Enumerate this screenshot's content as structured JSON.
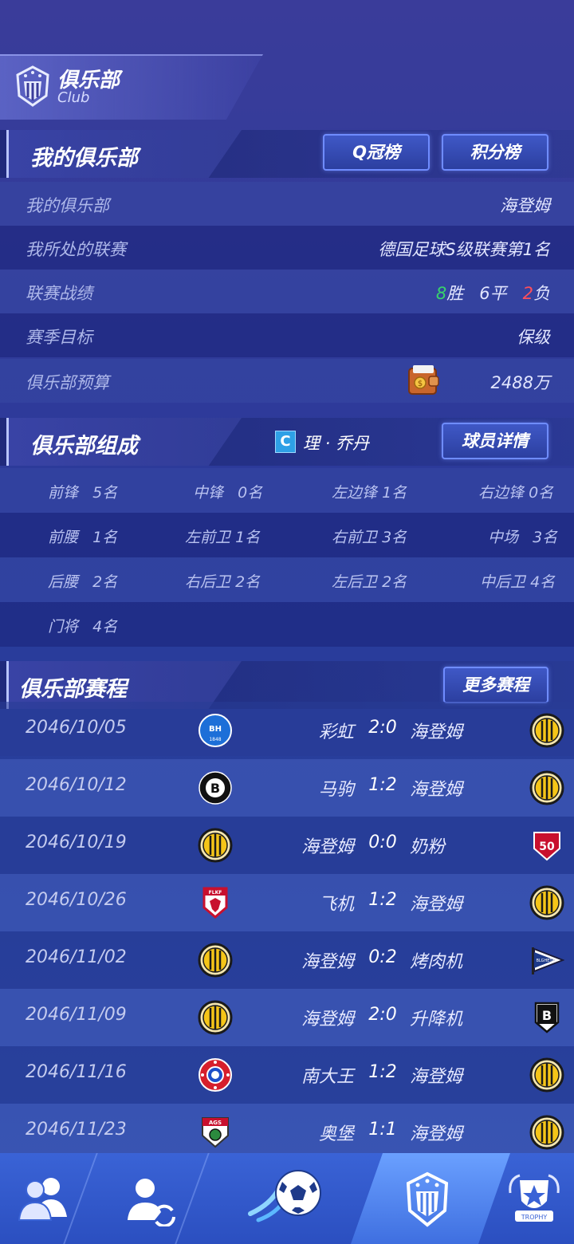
{
  "header": {
    "title": "俱乐部",
    "subtitle": "Club"
  },
  "my_club": {
    "title": "我的俱乐部",
    "q_rank_button": "Q冠榜",
    "points_button": "积分榜",
    "rows": [
      {
        "label": "我的俱乐部",
        "value": "海登姆"
      },
      {
        "label": "我所处的联赛",
        "value": "德国足球S级联赛第1名"
      },
      {
        "label": "联赛战绩",
        "wins": "8",
        "win_label": "胜",
        "draws": "6平",
        "losses": "2",
        "loss_label": "负"
      },
      {
        "label": "赛季目标",
        "value": "保级"
      },
      {
        "label": "俱乐部预算",
        "value": "2488万"
      }
    ]
  },
  "composition": {
    "title": "俱乐部组成",
    "captain_badge": "C",
    "captain_name": "理 · 乔丹",
    "details_button": "球员详情",
    "positions": [
      {
        "label": "前锋",
        "count": "5名"
      },
      {
        "label": "中锋",
        "count": "0名"
      },
      {
        "label": "左边锋",
        "count": "1名"
      },
      {
        "label": "右边锋",
        "count": "0名"
      },
      {
        "label": "前腰",
        "count": "1名"
      },
      {
        "label": "左前卫",
        "count": "1名"
      },
      {
        "label": "右前卫",
        "count": "3名"
      },
      {
        "label": "中场",
        "count": "3名"
      },
      {
        "label": "后腰",
        "count": "2名"
      },
      {
        "label": "右后卫",
        "count": "2名"
      },
      {
        "label": "左后卫",
        "count": "2名"
      },
      {
        "label": "中后卫",
        "count": "4名"
      },
      {
        "label": "门将",
        "count": "4名"
      }
    ]
  },
  "schedule": {
    "title": "俱乐部赛程",
    "more_button": "更多赛程",
    "matches": [
      {
        "date": "2046/10/05",
        "home": "彩虹",
        "score": "2:0",
        "away": "海登姆"
      },
      {
        "date": "2046/10/12",
        "home": "马驹",
        "score": "1:2",
        "away": "海登姆"
      },
      {
        "date": "2046/10/19",
        "home": "海登姆",
        "score": "0:0",
        "away": "奶粉"
      },
      {
        "date": "2046/10/26",
        "home": "飞机",
        "score": "1:2",
        "away": "海登姆"
      },
      {
        "date": "2046/11/02",
        "home": "海登姆",
        "score": "0:2",
        "away": "烤肉机"
      },
      {
        "date": "2046/11/09",
        "home": "海登姆",
        "score": "2:0",
        "away": "升降机"
      },
      {
        "date": "2046/11/16",
        "home": "南大王",
        "score": "1:2",
        "away": "海登姆"
      },
      {
        "date": "2046/11/23",
        "home": "奥堡",
        "score": "1:1",
        "away": "海登姆"
      }
    ],
    "badge_text": {
      "bh": "BH",
      "bh_year": "1848",
      "b": "B",
      "fifty": "50",
      "flkf": "FLKF",
      "ags": "AGS",
      "blgheta": "BLGHETA"
    }
  },
  "nav": {
    "trophy_label": "TROPHY"
  },
  "colors": {
    "win": "#38d36b",
    "loss": "#ff4f5b",
    "accent": "#6f8cff"
  }
}
